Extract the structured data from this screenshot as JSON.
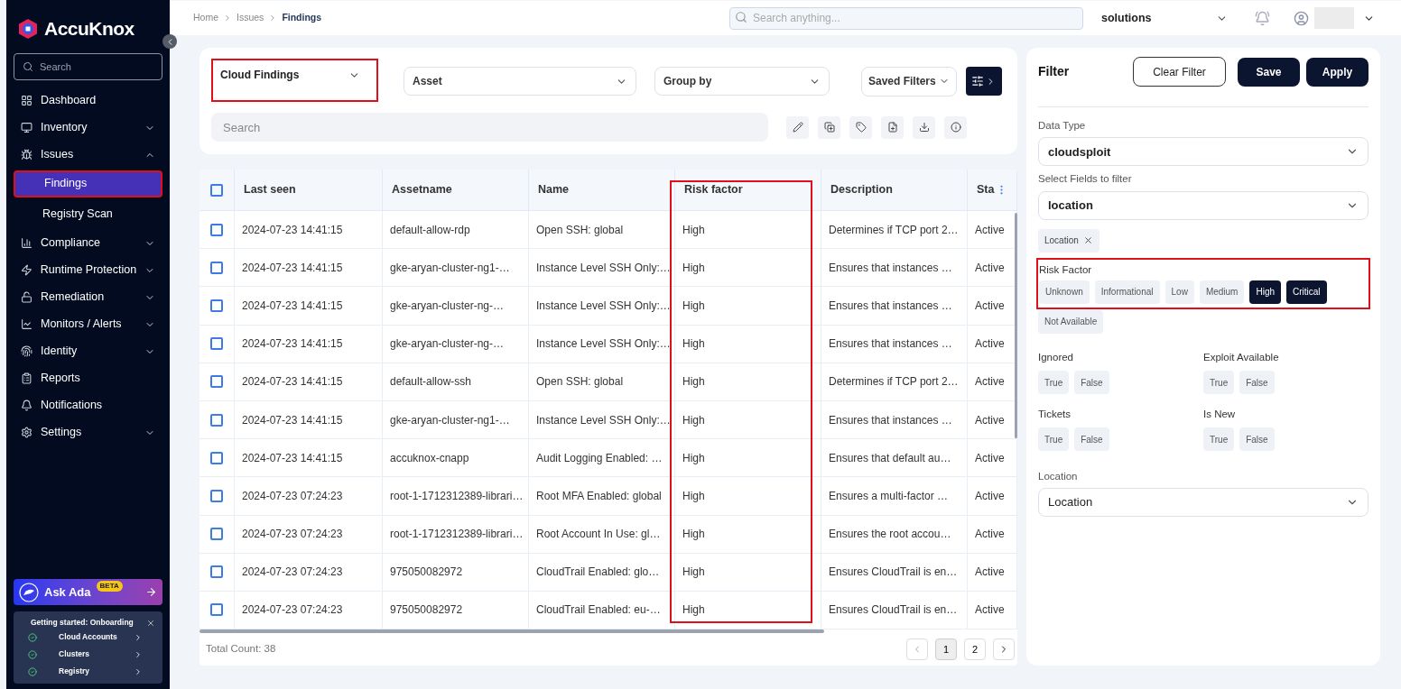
{
  "sidebar": {
    "logo": "AccuKnox",
    "search": {
      "placeholder": "Search"
    },
    "items": [
      {
        "label": "Dashboard",
        "expandable": false,
        "selected": false
      },
      {
        "label": "Inventory",
        "expandable": true,
        "expanded": false,
        "selected": false
      },
      {
        "label": "Issues",
        "expandable": true,
        "expanded": true,
        "selected": false,
        "children": [
          {
            "label": "Findings",
            "selected": true
          },
          {
            "label": "Registry Scan",
            "selected": false
          }
        ]
      },
      {
        "label": "Compliance",
        "expandable": true,
        "expanded": false,
        "selected": false
      },
      {
        "label": "Runtime Protection",
        "expandable": true,
        "expanded": false,
        "selected": false
      },
      {
        "label": "Remediation",
        "expandable": true,
        "expanded": false,
        "selected": false
      },
      {
        "label": "Monitors / Alerts",
        "expandable": true,
        "expanded": false,
        "selected": false
      },
      {
        "label": "Identity",
        "expandable": true,
        "expanded": false,
        "selected": false
      },
      {
        "label": "Reports",
        "expandable": false,
        "selected": false
      },
      {
        "label": "Notifications",
        "expandable": false,
        "selected": false
      },
      {
        "label": "Settings",
        "expandable": true,
        "expanded": false,
        "selected": false
      }
    ],
    "ask_ada": {
      "label": "Ask Ada",
      "badge": "BETA"
    },
    "onboarding": {
      "title": "Getting started: Onboarding",
      "steps": [
        {
          "label": "Cloud Accounts",
          "done": true
        },
        {
          "label": "Clusters",
          "done": true
        },
        {
          "label": "Registry",
          "done": true
        }
      ]
    }
  },
  "topbar": {
    "breadcrumb": [
      "Home",
      "Issues",
      "Findings"
    ],
    "search": {
      "placeholder": "Search anything..."
    },
    "workspace": "solutions"
  },
  "toolbar": {
    "dropdowns": [
      "Cloud Findings",
      "Asset",
      "Group by"
    ],
    "saved_filters": "Saved Filters",
    "search": {
      "placeholder": "Search"
    }
  },
  "table": {
    "columns": [
      "Last seen",
      "Assetname",
      "Name",
      "Risk factor",
      "Description",
      "Sta"
    ],
    "all_checked": false,
    "rows": [
      {
        "checked": false,
        "cells": [
          "2024-07-23 14:41:15",
          "default-allow-rdp",
          "Open SSH: global",
          "High",
          "Determines if TCP port 2…",
          "Active"
        ]
      },
      {
        "checked": false,
        "cells": [
          "2024-07-23 14:41:15",
          "gke-aryan-cluster-ng1-…",
          "Instance Level SSH Only:…",
          "High",
          "Ensures that instances …",
          "Active"
        ]
      },
      {
        "checked": false,
        "cells": [
          "2024-07-23 14:41:15",
          "gke-aryan-cluster-ng-…",
          "Instance Level SSH Only:…",
          "High",
          "Ensures that instances …",
          "Active"
        ]
      },
      {
        "checked": false,
        "cells": [
          "2024-07-23 14:41:15",
          "gke-aryan-cluster-ng-…",
          "Instance Level SSH Only:…",
          "High",
          "Ensures that instances …",
          "Active"
        ]
      },
      {
        "checked": false,
        "cells": [
          "2024-07-23 14:41:15",
          "default-allow-ssh",
          "Open SSH: global",
          "High",
          "Determines if TCP port 2…",
          "Active"
        ]
      },
      {
        "checked": false,
        "cells": [
          "2024-07-23 14:41:15",
          "gke-aryan-cluster-ng1-…",
          "Instance Level SSH Only:…",
          "High",
          "Ensures that instances …",
          "Active"
        ]
      },
      {
        "checked": false,
        "cells": [
          "2024-07-23 14:41:15",
          "accuknox-cnapp",
          "Audit Logging Enabled: …",
          "High",
          "Ensures that default au…",
          "Active"
        ]
      },
      {
        "checked": false,
        "cells": [
          "2024-07-23 07:24:23",
          "root-1-1712312389-librari…",
          "Root MFA Enabled: global",
          "High",
          "Ensures a multi-factor …",
          "Active"
        ]
      },
      {
        "checked": false,
        "cells": [
          "2024-07-23 07:24:23",
          "root-1-1712312389-librari…",
          "Root Account In Use: gl…",
          "High",
          "Ensures the root accou…",
          "Active"
        ]
      },
      {
        "checked": false,
        "cells": [
          "2024-07-23 07:24:23",
          "975050082972",
          "CloudTrail Enabled: glo…",
          "High",
          "Ensures CloudTrail is en…",
          "Active"
        ]
      },
      {
        "checked": false,
        "cells": [
          "2024-07-23 07:24:23",
          "975050082972",
          "CloudTrail Enabled: eu-…",
          "High",
          "Ensures CloudTrail is en…",
          "Active"
        ]
      }
    ],
    "total": "Total Count: 38",
    "pages": [
      {
        "label": "1",
        "selected": true
      },
      {
        "label": "2",
        "selected": false
      }
    ]
  },
  "filter": {
    "title": "Filter",
    "buttons": [
      "Clear Filter",
      "Save",
      "Apply"
    ],
    "data_type": {
      "label": "Data Type",
      "value": "cloudsploit"
    },
    "fields": {
      "label": "Select Fields to filter",
      "value": "location"
    },
    "tags": [
      "Location"
    ],
    "risk_factor": {
      "label": "Risk Factor",
      "options": [
        {
          "label": "Unknown",
          "selected": false
        },
        {
          "label": "Informational",
          "selected": false
        },
        {
          "label": "Low",
          "selected": false
        },
        {
          "label": "Medium",
          "selected": false
        },
        {
          "label": "High",
          "selected": true
        },
        {
          "label": "Critical",
          "selected": true
        },
        {
          "label": "Not Available",
          "selected": false
        }
      ]
    },
    "toggles": [
      {
        "label": "Ignored",
        "options": [
          {
            "label": "True",
            "selected": false
          },
          {
            "label": "False",
            "selected": false
          }
        ]
      },
      {
        "label": "Exploit Available",
        "options": [
          {
            "label": "True",
            "selected": false
          },
          {
            "label": "False",
            "selected": false
          }
        ]
      },
      {
        "label": "Tickets",
        "options": [
          {
            "label": "True",
            "selected": false
          },
          {
            "label": "False",
            "selected": false
          }
        ]
      },
      {
        "label": "Is New",
        "options": [
          {
            "label": "True",
            "selected": false
          },
          {
            "label": "False",
            "selected": false
          }
        ]
      }
    ],
    "location": {
      "label": "Location",
      "value": "Location"
    }
  }
}
